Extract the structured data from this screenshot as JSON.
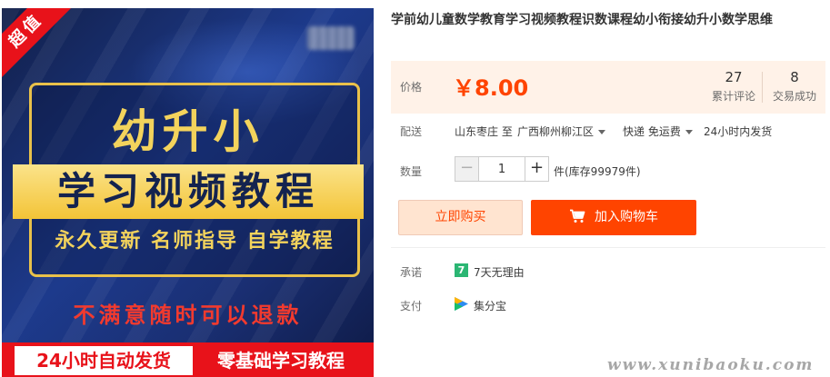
{
  "product_image": {
    "corner_badge": "超值",
    "headline": "幼升小",
    "ribbon": "学习视频教程",
    "features": "永久更新 名师指导 自学教程",
    "refund": "不满意随时可以退款",
    "bottom_left": "24小时自动发货",
    "bottom_right": "零基础学习教程"
  },
  "product": {
    "title": "学前幼儿童数学教育学习视频教程识数课程幼小衔接幼升小数学思维"
  },
  "price": {
    "label": "价格",
    "value": "￥8.00",
    "reviews_count": "27",
    "reviews_label": "累计评论",
    "sales_count": "8",
    "sales_label": "交易成功"
  },
  "delivery": {
    "label": "配送",
    "from": "山东枣庄 至",
    "to": "广西柳州柳江区",
    "method": "快递 免运费",
    "dispatch": "24小时内发货"
  },
  "quantity": {
    "label": "数量",
    "minus": "−",
    "value": "1",
    "plus": "+",
    "stock": "件(库存99979件)"
  },
  "actions": {
    "buy_now": "立即购买",
    "add_to_cart": "加入购物车"
  },
  "promise": {
    "label": "承诺",
    "icon_text": "7",
    "text": "7天无理由"
  },
  "payment": {
    "label": "支付",
    "text": "集分宝"
  },
  "watermark": "www.xunibaoku.com",
  "colors": {
    "accent": "#ff4400",
    "price_bg": "#fff2e8",
    "buy_now_bg": "#ffe4d0",
    "promise_icon": "#2bb673"
  },
  "icons": {
    "cart": "shopping-cart-icon",
    "promise": "seven-days-icon",
    "payment": "jifenbao-icon"
  }
}
